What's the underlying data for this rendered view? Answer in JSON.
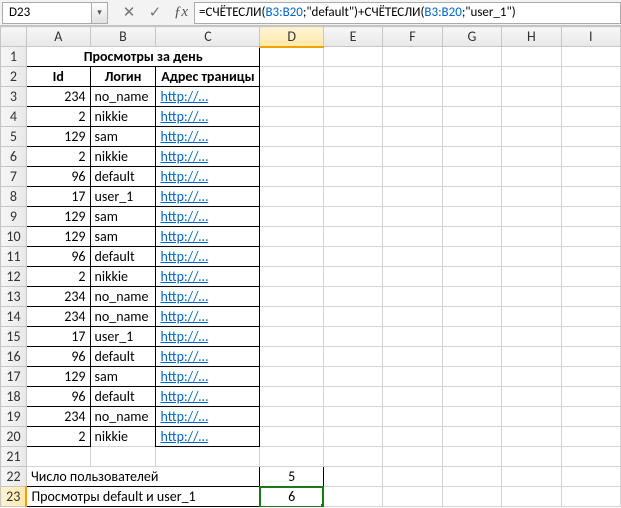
{
  "namebox": "D23",
  "formula": {
    "prefix": "=СЧЁТЕСЛИ(",
    "range": "B3:B20",
    "mid1": ";\"default\")+СЧЁТЕСЛИ(",
    "mid2": ";\"user_1\")"
  },
  "columns": [
    "A",
    "B",
    "C",
    "D",
    "E",
    "F",
    "G",
    "H",
    "I"
  ],
  "title_row": "Просмотры за день",
  "headers": {
    "a": "Id",
    "b": "Логин",
    "c": "Адрес траницы"
  },
  "rows": [
    {
      "id": "234",
      "login": "no_name",
      "url": "http://…"
    },
    {
      "id": "2",
      "login": "nikkie",
      "url": "http://…"
    },
    {
      "id": "129",
      "login": "sam",
      "url": "http://…"
    },
    {
      "id": "2",
      "login": "nikkie",
      "url": "http://…"
    },
    {
      "id": "96",
      "login": "default",
      "url": "http://…"
    },
    {
      "id": "17",
      "login": "user_1",
      "url": "http://…"
    },
    {
      "id": "129",
      "login": "sam",
      "url": "http://…"
    },
    {
      "id": "129",
      "login": "sam",
      "url": "http://…"
    },
    {
      "id": "96",
      "login": "default",
      "url": "http://…"
    },
    {
      "id": "2",
      "login": "nikkie",
      "url": "http://…"
    },
    {
      "id": "234",
      "login": "no_name",
      "url": "http://…"
    },
    {
      "id": "234",
      "login": "no_name",
      "url": "http://…"
    },
    {
      "id": "17",
      "login": "user_1",
      "url": "http://…"
    },
    {
      "id": "96",
      "login": "default",
      "url": "http://…"
    },
    {
      "id": "129",
      "login": "sam",
      "url": "http://…"
    },
    {
      "id": "96",
      "login": "default",
      "url": "http://…"
    },
    {
      "id": "234",
      "login": "no_name",
      "url": "http://…"
    },
    {
      "id": "2",
      "login": "nikkie",
      "url": "http://…"
    }
  ],
  "summary": {
    "r22_label": "Число пользователей",
    "r22_value": "5",
    "r23_label": "Просмотры default и user_1",
    "r23_value": "6"
  }
}
